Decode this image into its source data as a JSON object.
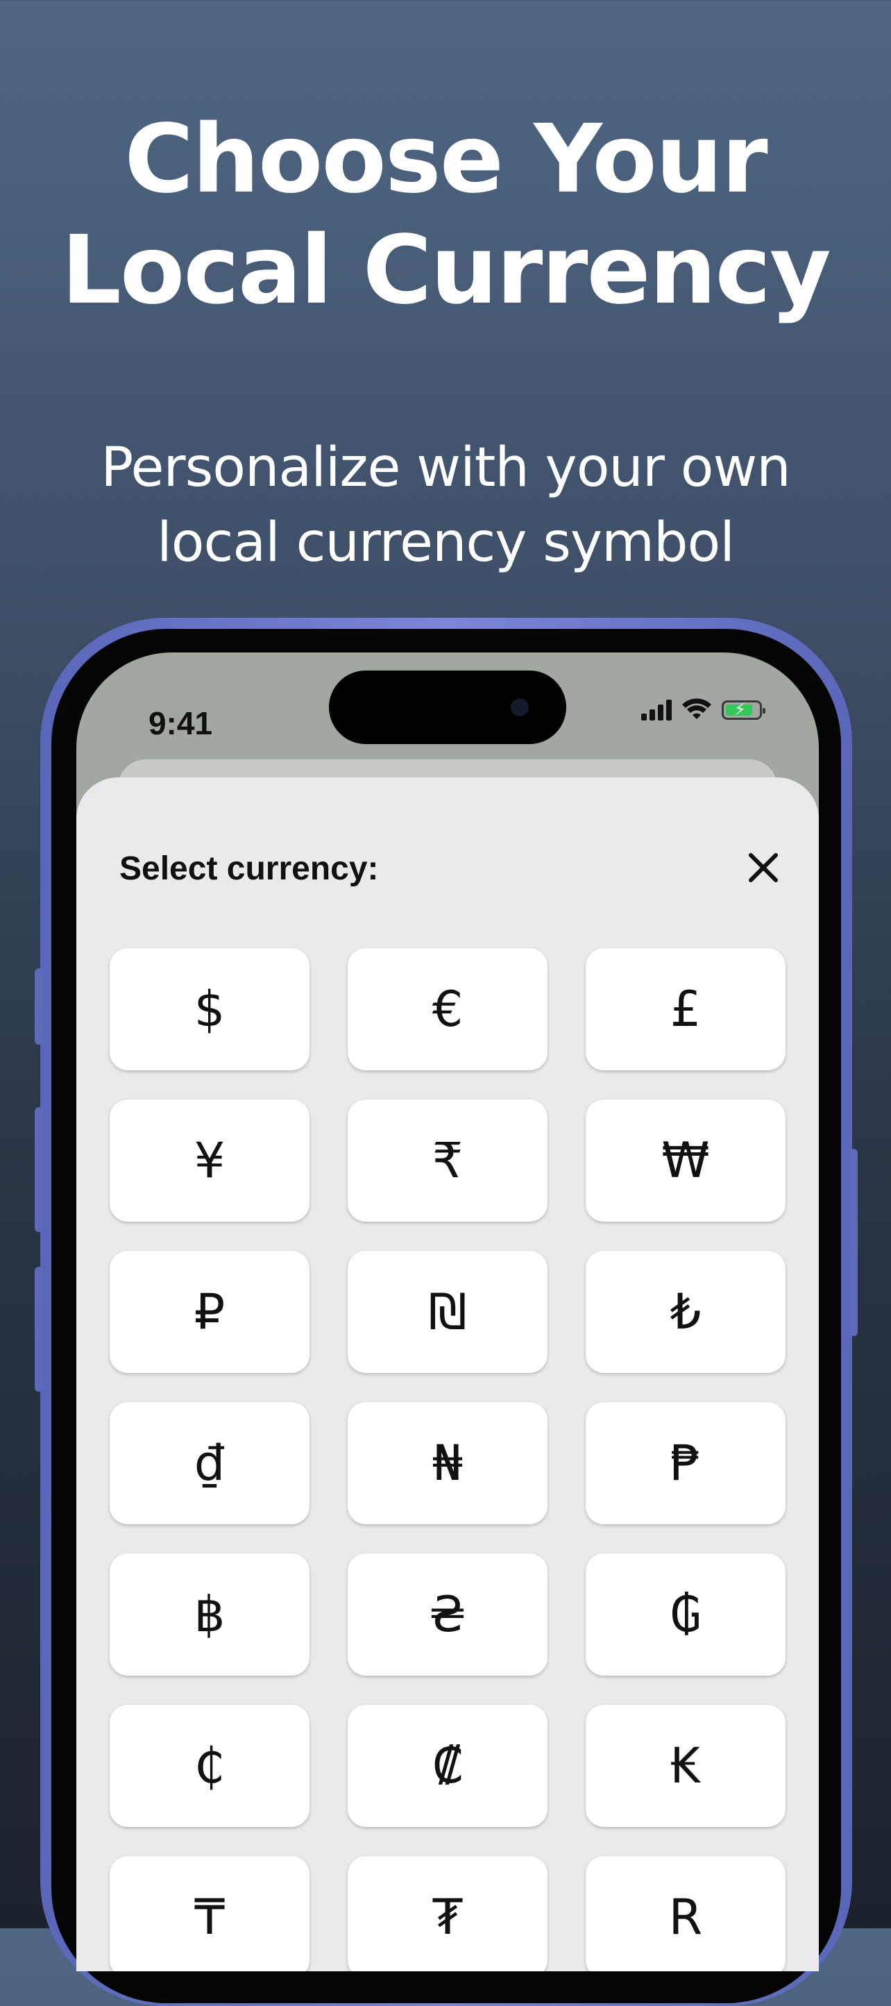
{
  "promo": {
    "headline_line1": "Choose Your",
    "headline_line2": "Local Currency",
    "subheadline_line1": "Personalize with your own",
    "subheadline_line2": "local currency symbol"
  },
  "status_bar": {
    "time": "9:41",
    "icons": [
      "signal-icon",
      "wifi-icon",
      "battery-charging-icon"
    ]
  },
  "sheet": {
    "title": "Select currency:",
    "close_icon": "close-icon",
    "currencies": [
      "$",
      "€",
      "£",
      "¥",
      "₹",
      "₩",
      "₽",
      "₪",
      "₺",
      "₫",
      "₦",
      "₱",
      "฿",
      "₴",
      "₲",
      "₵",
      "₡",
      "₭",
      "₸",
      "₮",
      "R"
    ]
  },
  "colors": {
    "background_top": "#4f6784",
    "background_bottom": "#1c222c",
    "phone_frame": "#6a76c8",
    "sheet_background": "#eaeaec",
    "button_background": "#ffffff",
    "battery_green": "#34c759"
  }
}
